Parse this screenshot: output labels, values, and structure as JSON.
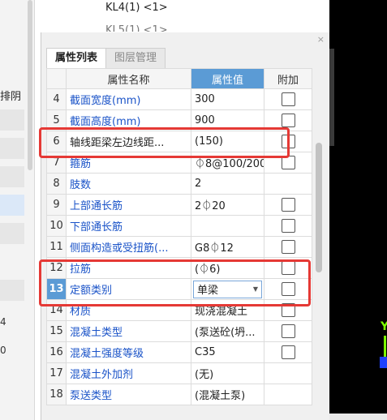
{
  "left_panel": {
    "partial_label": "排阴",
    "partial_numbers": [
      "4",
      "0"
    ]
  },
  "tree": {
    "items": [
      "KL4(1) <1>",
      "KL5(1) <1>"
    ]
  },
  "panel": {
    "close": "×",
    "tabs": [
      "属性列表",
      "图层管理"
    ],
    "headers": {
      "name": "属性名称",
      "value": "属性值",
      "attach": "附加"
    }
  },
  "rows": [
    {
      "num": "4",
      "name": "截面宽度(mm)",
      "value": "300"
    },
    {
      "num": "5",
      "name": "截面高度(mm)",
      "value": "900"
    },
    {
      "num": "6",
      "name": "轴线距梁左边线距...",
      "value": "(150)"
    },
    {
      "num": "7",
      "name": "箍筋",
      "value": "⏀8@100/200"
    },
    {
      "num": "8",
      "name": "肢数",
      "value": "2"
    },
    {
      "num": "9",
      "name": "上部通长筋",
      "value": "2⏀20"
    },
    {
      "num": "10",
      "name": "下部通长筋",
      "value": ""
    },
    {
      "num": "11",
      "name": "侧面构造或受扭筋(...",
      "value": "G8⏀12"
    },
    {
      "num": "12",
      "name": "拉筋",
      "value": "(⏀6)"
    },
    {
      "num": "13",
      "name": "定额类别",
      "value": "单梁"
    },
    {
      "num": "14",
      "name": "材质",
      "value": "现浇混凝土"
    },
    {
      "num": "15",
      "name": "混凝土类型",
      "value": "(泵送砼(坍..."
    },
    {
      "num": "16",
      "name": "混凝土强度等级",
      "value": "C35"
    },
    {
      "num": "17",
      "name": "混凝土外加剂",
      "value": "(无)"
    },
    {
      "num": "18",
      "name": "泵送类型",
      "value": "(混凝土泵)"
    }
  ],
  "viewport": {
    "axis_label": "Y"
  },
  "colors": {
    "highlight_red": "#e53935",
    "header_blue": "#5b9bd5",
    "link_blue": "#1a53c8"
  }
}
